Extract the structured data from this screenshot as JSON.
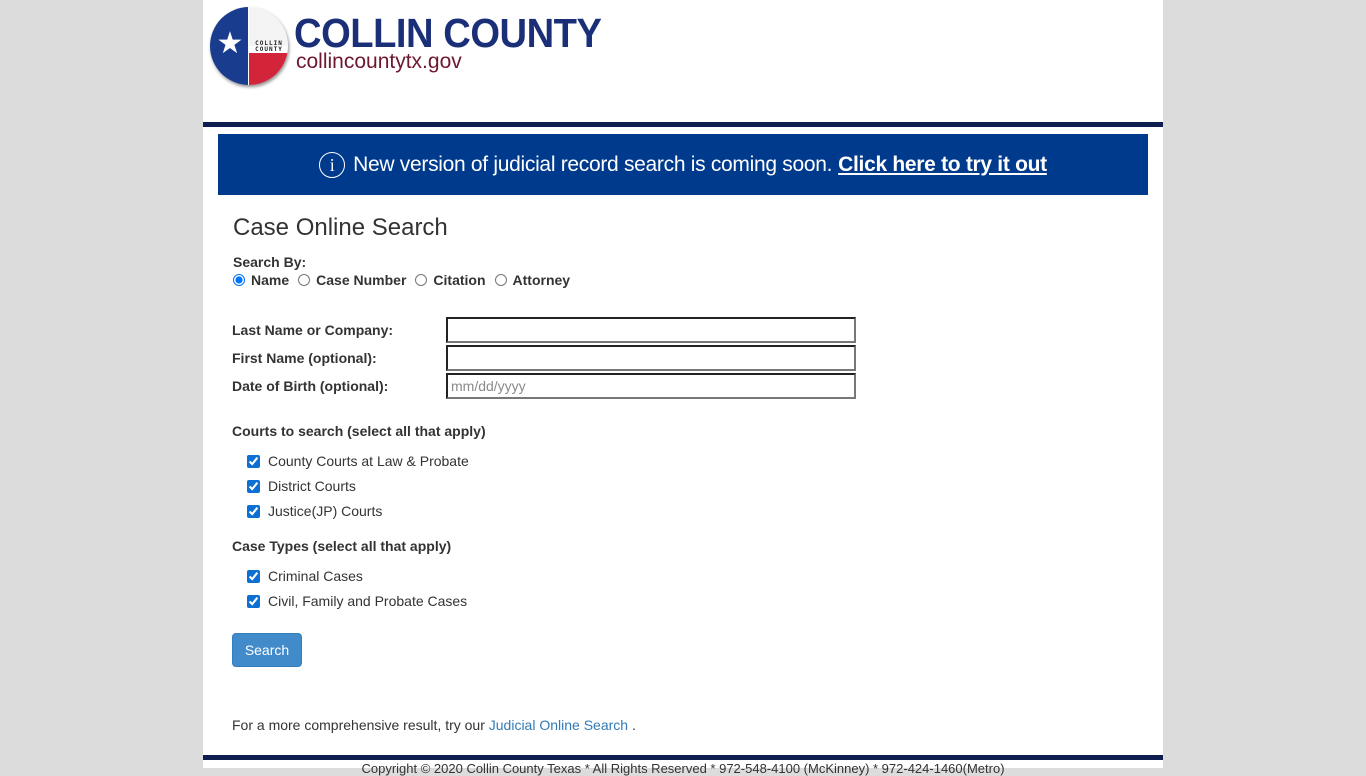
{
  "header": {
    "seal_text": "COLLIN COUNTY",
    "title": "COLLIN COUNTY",
    "url": "collincountytx.gov"
  },
  "banner": {
    "icon": "info-icon",
    "message": "New version of judicial record search is coming soon.",
    "link_label": "Click here to try it out"
  },
  "form": {
    "title": "Case Online Search",
    "search_by_label": "Search By:",
    "search_by_options": [
      {
        "label": "Name",
        "selected": true
      },
      {
        "label": "Case Number",
        "selected": false
      },
      {
        "label": "Citation",
        "selected": false
      },
      {
        "label": "Attorney",
        "selected": false
      }
    ],
    "fields": [
      {
        "label": "Last Name or Company:",
        "value": "",
        "placeholder": ""
      },
      {
        "label": "First Name (optional):",
        "value": "",
        "placeholder": ""
      },
      {
        "label": "Date of Birth (optional):",
        "value": "",
        "placeholder": "mm/dd/yyyy"
      }
    ],
    "courts_title": "Courts to search (select all that apply)",
    "courts": [
      {
        "label": "County Courts at Law & Probate",
        "checked": true
      },
      {
        "label": "District Courts",
        "checked": true
      },
      {
        "label": "Justice(JP) Courts",
        "checked": true
      }
    ],
    "case_types_title": "Case Types (select all that apply)",
    "case_types": [
      {
        "label": "Criminal Cases",
        "checked": true
      },
      {
        "label": "Civil, Family and Probate Cases",
        "checked": true
      }
    ],
    "search_button": "Search",
    "more_note_prefix": "For a more comprehensive result, try our",
    "more_note_link": "Judicial Online Search",
    "more_note_suffix": "."
  },
  "footer": {
    "text": "Copyright © 2020 Collin County Texas * All Rights Reserved * 972-548-4100 (McKinney) * 972-424-1460(Metro)"
  },
  "colors": {
    "navy": "#0d1e4f",
    "banner_blue": "#003a8c",
    "button_blue": "#428bca",
    "link_blue": "#337ab7",
    "brand_maroon": "#6e1830"
  }
}
